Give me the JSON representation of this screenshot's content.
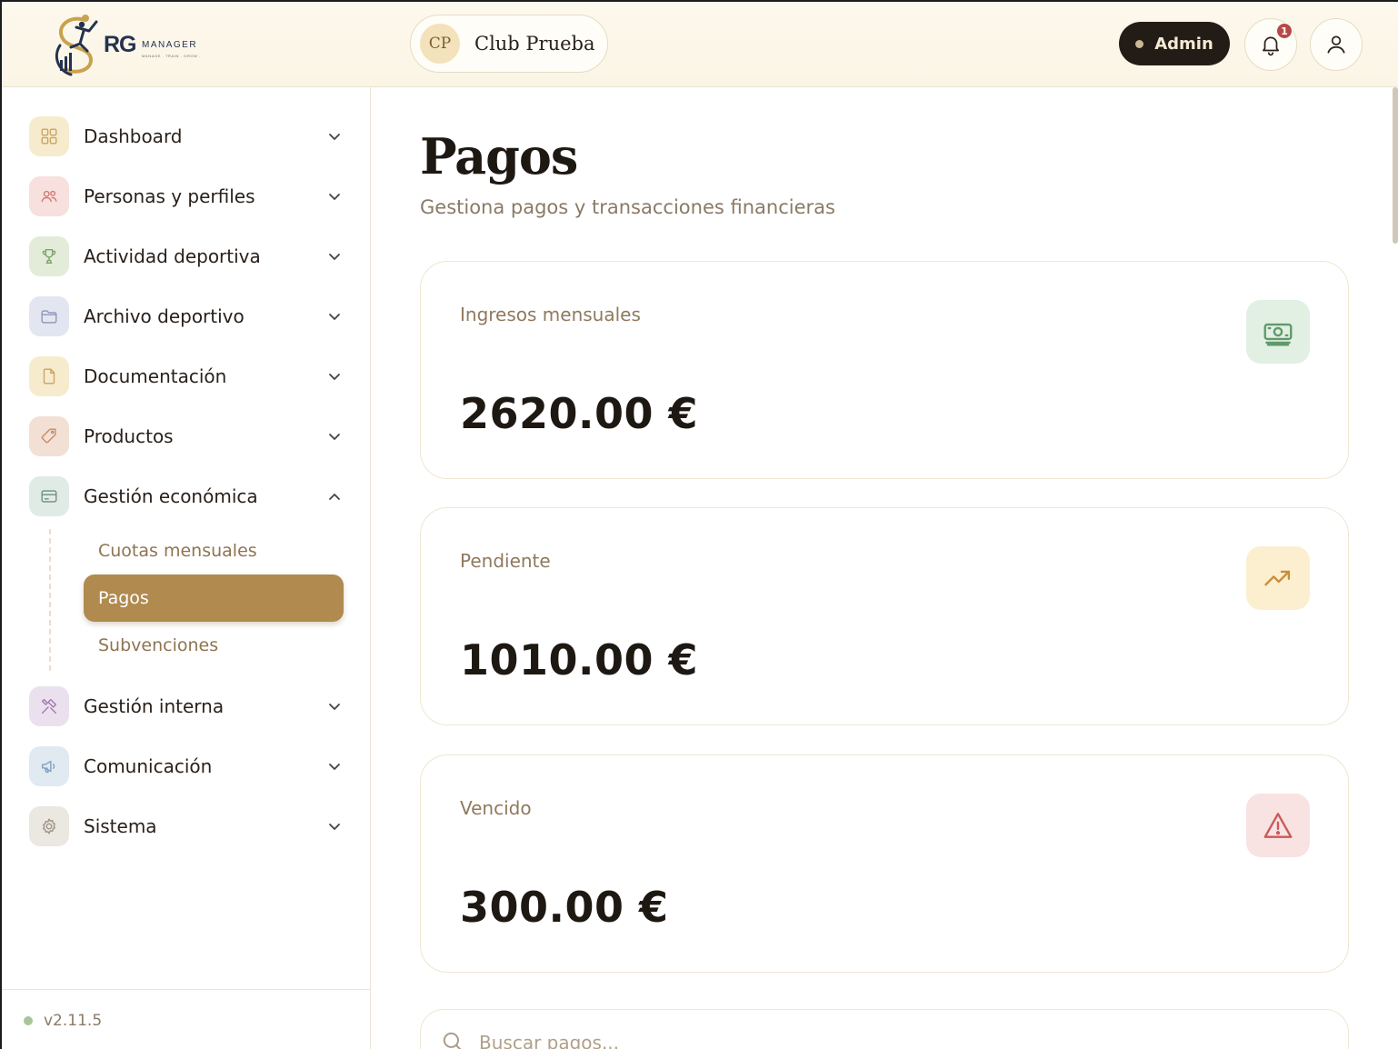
{
  "brand": {
    "name": "RG",
    "suffix": "MANAGER",
    "tagline": "MANAGE . TRAIN . GROW ."
  },
  "header": {
    "club_initials": "CP",
    "club_name": "Club Prueba",
    "role_label": "Admin",
    "notification_count": "1"
  },
  "sidebar": {
    "items": [
      {
        "label": "Dashboard",
        "icon": "grid-icon",
        "color": "#f6ebcd"
      },
      {
        "label": "Personas y perfiles",
        "icon": "users-icon",
        "color": "#f7e0dd"
      },
      {
        "label": "Actividad deportiva",
        "icon": "trophy-icon",
        "color": "#e3ecd9"
      },
      {
        "label": "Archivo deportivo",
        "icon": "folder-icon",
        "color": "#e3e6f0"
      },
      {
        "label": "Documentación",
        "icon": "document-icon",
        "color": "#f6ebcd"
      },
      {
        "label": "Productos",
        "icon": "tag-icon",
        "color": "#f3e0d4"
      },
      {
        "label": "Gestión económica",
        "icon": "credit-card-icon",
        "color": "#e1ebe5"
      },
      {
        "label": "Gestión interna",
        "icon": "tools-icon",
        "color": "#ebe1ee"
      },
      {
        "label": "Comunicación",
        "icon": "megaphone-icon",
        "color": "#e1e9f1"
      },
      {
        "label": "Sistema",
        "icon": "gear-icon",
        "color": "#ebe7e1"
      }
    ],
    "sub_items": [
      {
        "label": "Cuotas mensuales",
        "active": false
      },
      {
        "label": "Pagos",
        "active": true
      },
      {
        "label": "Subvenciones",
        "active": false
      }
    ],
    "version": "v2.11.5"
  },
  "main": {
    "title": "Pagos",
    "subtitle": "Gestiona pagos y transacciones financieras",
    "stats": [
      {
        "label": "Ingresos mensuales",
        "value": "2620.00 €",
        "icon": "banknote-icon",
        "color": "#e2efe3"
      },
      {
        "label": "Pendiente",
        "value": "1010.00 €",
        "icon": "trending-up-icon",
        "color": "#fbefcf"
      },
      {
        "label": "Vencido",
        "value": "300.00 €",
        "icon": "alert-triangle-icon",
        "color": "#f8e2e2"
      }
    ],
    "search_placeholder": "Buscar pagos..."
  }
}
